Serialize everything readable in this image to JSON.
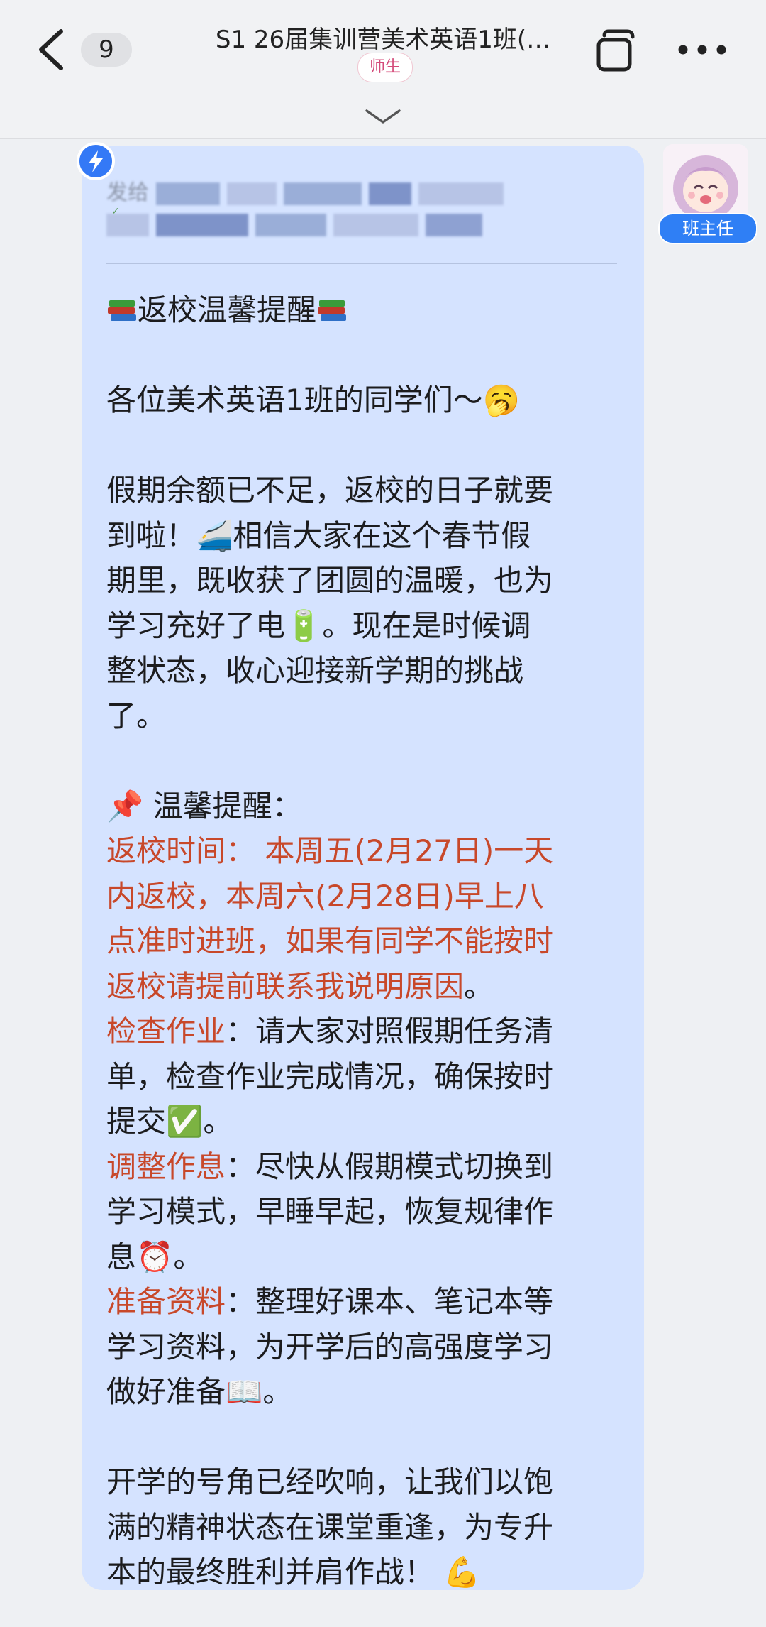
{
  "header": {
    "unread_count": "9",
    "title": "S1 26届集训营美术英语1班(…",
    "role_tag": "师生"
  },
  "message": {
    "recipients_label": "发给",
    "heading": "返校温馨提醒",
    "greeting": "各位美术英语1班的同学们～",
    "intro_1": "假期余额已不足，返校的日子就要",
    "intro_2a": "到啦！",
    "intro_2b": "相信大家在这个春节假",
    "intro_3": "期里，既收获了团圆的温暖，也为",
    "intro_4a": "学习充好了电",
    "intro_4b": "。现在是时候调",
    "intro_5": "整状态，收心迎接新学期的挑战",
    "intro_6": "了。",
    "tips_title": "温馨提醒：",
    "tip1_line1": "返校时间：  本周五(2月27日)一天",
    "tip1_line2": "内返校，本周六(2月28日)早上八",
    "tip1_line3": "点准时进班，如果有同学不能按时",
    "tip1_line4a": "返校请提前联系我说明原因",
    "tip1_line4b": "。",
    "tip2_label": "检查作业",
    "tip2_line1": "：请大家对照假期任务清",
    "tip2_line2": "单，检查作业完成情况，确保按时",
    "tip2_line3a": "提交",
    "tip2_line3b": "。",
    "tip3_label": "调整作息",
    "tip3_line1": "：尽快从假期模式切换到",
    "tip3_line2": "学习模式，早睡早起，恢复规律作",
    "tip3_line3a": "息",
    "tip3_line3b": "。",
    "tip4_label": "准备资料",
    "tip4_line1": "：整理好课本、笔记本等",
    "tip4_line2": "学习资料，为开学后的高强度学习",
    "tip4_line3a": "做好准备",
    "tip4_line3b": "。",
    "closing_1": "开学的号角已经吹响，让我们以饱",
    "closing_2": "满的精神状态在课堂重逢，为专升",
    "closing_3": "本的最终胜利并肩作战！",
    "emoji": {
      "pensive": "🥱",
      "train": "🚄",
      "battery": "🔋",
      "pin": "📌",
      "check": "✅",
      "alarm": "⏰",
      "book": "📖",
      "muscle": "💪"
    }
  },
  "sender": {
    "role_badge": "班主任"
  },
  "colors": {
    "bubble": "#d5e3ff",
    "highlight_red": "#c8482a",
    "accent_blue": "#2f7ff5"
  }
}
